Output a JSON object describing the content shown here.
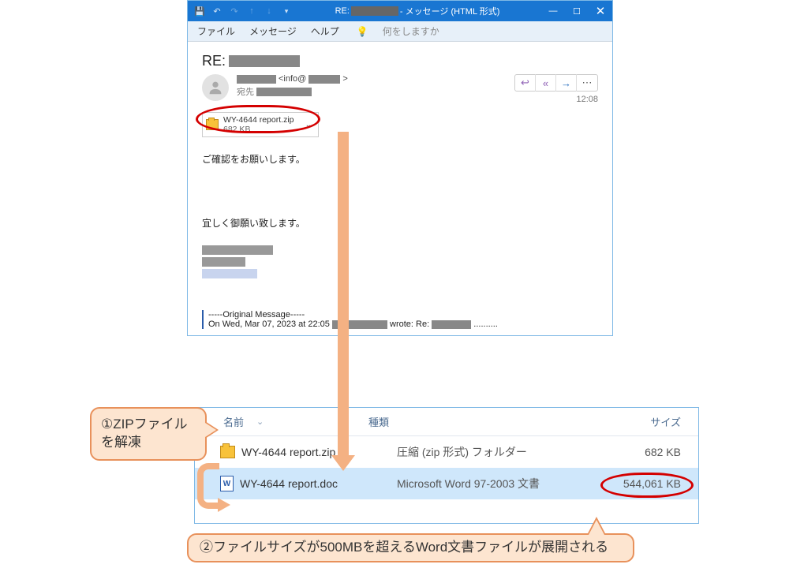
{
  "window": {
    "title_prefix": "RE:",
    "title_suffix": " - メッセージ (HTML 形式)"
  },
  "ribbon": {
    "tab_file": "ファイル",
    "tab_message": "メッセージ",
    "tab_help": "ヘルプ",
    "tellme": "何をしますか"
  },
  "message": {
    "subject_prefix": "RE:",
    "sender_email_prefix": "<info@",
    "sender_email_suffix": ">",
    "recipients_label": "宛先",
    "time": "12:08",
    "attachment": {
      "name": "WY-4644 report.zip",
      "size": "682 KB"
    },
    "body_line1": "ご確認をお願いします。",
    "body_line2": "宜しく御願い致します。",
    "original_line1": "-----Original Message-----",
    "original_line2a": "On Wed, Mar 07, 2023 at 22:05",
    "original_line2b": " wrote: Re:",
    "original_line2c": " .........."
  },
  "explorer": {
    "col_name": "名前",
    "col_type": "種類",
    "col_size": "サイズ",
    "rows": [
      {
        "name": "WY-4644 report.zip",
        "type": "圧縮 (zip 形式) フォルダー",
        "size": "682 KB"
      },
      {
        "name": "WY-4644 report.doc",
        "type": "Microsoft Word 97-2003 文書",
        "size": "544,061 KB"
      }
    ]
  },
  "callouts": {
    "c1": "①ZIPファイルを解凍",
    "c2": "②ファイルサイズが500MBを超えるWord文書ファイルが展開される"
  }
}
